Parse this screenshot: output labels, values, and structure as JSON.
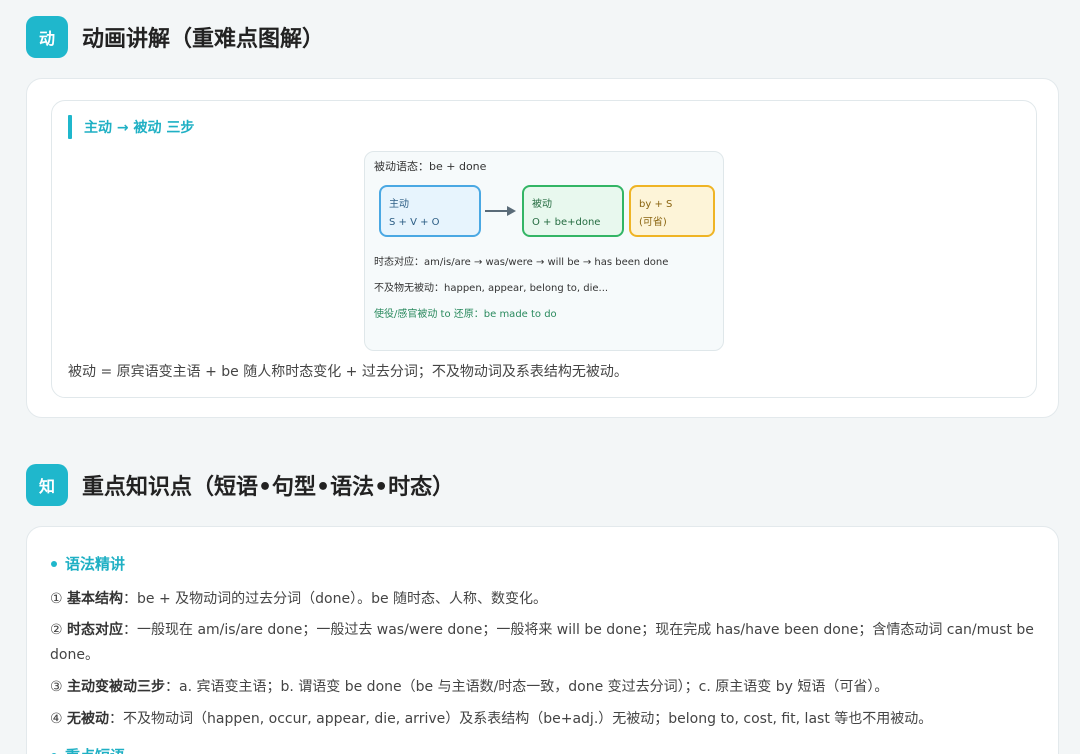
{
  "section1": {
    "badge": "动",
    "title": "动画讲解（重难点图解）",
    "subtitle": "主动 → 被动 三步",
    "diagram": {
      "title": "被动语态：be + done",
      "active": {
        "label": "主动",
        "formula": "S + V + O"
      },
      "passive": {
        "label": "被动",
        "formula": "O + be+done"
      },
      "by": {
        "label": "by + S",
        "note": "(可省)"
      },
      "line1": "时态对应：am/is/are → was/were → will be → has been done",
      "line2": "不及物无被动：happen, appear, belong to, die...",
      "line3": "使役/感官被动 to 还原：be made to do"
    },
    "caption": "被动 = 原宾语变主语 + be 随人称时态变化 + 过去分词；不及物动词及系表结构无被动。"
  },
  "section2": {
    "badge": "知",
    "title": "重点知识点（短语•句型•语法•时态）",
    "grammar_heading": "语法精讲",
    "points": [
      {
        "num": "①",
        "label": "基本结构",
        "text": "：be + 及物动词的过去分词（done）。be 随时态、人称、数变化。"
      },
      {
        "num": "②",
        "label": "时态对应",
        "text": "：一般现在 am/is/are done；一般过去 was/were done；一般将来 will be done；现在完成 has/have been done；含情态动词 can/must be done。"
      },
      {
        "num": "③",
        "label": "主动变被动三步",
        "text": "：a. 宾语变主语；b. 谓语变 be done（be 与主语数/时态一致，done 变过去分词）；c. 原主语变 by 短语（可省）。"
      },
      {
        "num": "④",
        "label": "无被动",
        "text": "：不及物动词（happen, occur, appear, die, arrive）及系表结构（be+adj.）无被动；belong to, cost, fit, last 等也不用被动。"
      }
    ],
    "phrases_heading": "重点短语"
  },
  "colors": {
    "accent": "#1fb7cc",
    "active_border": "#4aa8e3",
    "passive_border": "#33b565",
    "by_border": "#efb425"
  }
}
